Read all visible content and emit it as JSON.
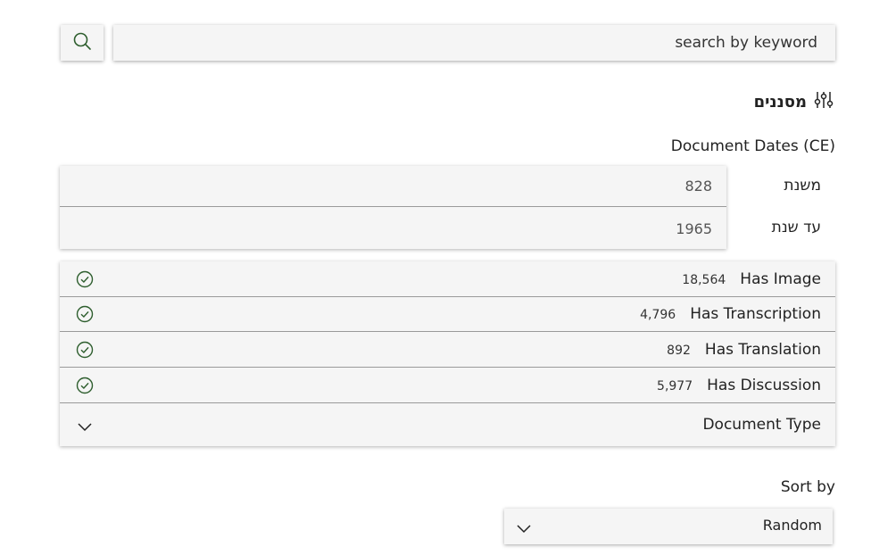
{
  "search": {
    "placeholder": "search by keyword",
    "button_icon": "search-icon"
  },
  "filters": {
    "title": "מסננים",
    "icon": "sliders-icon"
  },
  "dates": {
    "label": "Document Dates (CE)",
    "from_label": "משנת",
    "from_value": "828",
    "to_label": "עד שנת",
    "to_value": "1965"
  },
  "toggles": [
    {
      "label": "Has Image",
      "count": "18,564",
      "icon": "check-circle-icon"
    },
    {
      "label": "Has Transcription",
      "count": "4,796",
      "icon": "check-circle-icon"
    },
    {
      "label": "Has Translation",
      "count": "892",
      "icon": "check-circle-icon"
    },
    {
      "label": "Has Discussion",
      "count": "5,977",
      "icon": "check-circle-icon"
    }
  ],
  "document_type": {
    "label": "Document Type",
    "icon": "chevron-down-icon"
  },
  "sort": {
    "label": "Sort by",
    "value": "Random",
    "icon": "chevron-down-icon"
  },
  "colors": {
    "accent": "#2e5e2e",
    "panel": "#f5f5f5",
    "divider": "#9a9a9a"
  }
}
